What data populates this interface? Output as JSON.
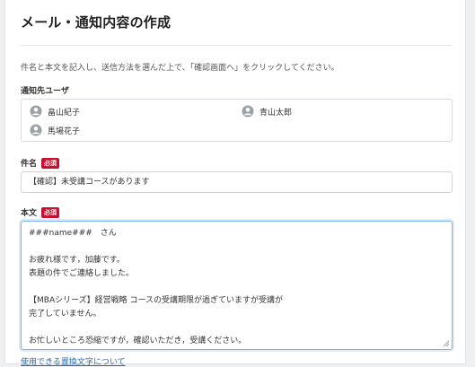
{
  "page": {
    "title": "メール・通知内容の作成",
    "instruction": "件名と本文を記入し、送信方法を選んだ上で、「確認画面へ」をクリックしてください。"
  },
  "recipients": {
    "label": "通知先ユーザ",
    "users": [
      "畠山紀子",
      "青山太郎",
      "馬場花子"
    ],
    "icon": "user-avatar-icon"
  },
  "subject": {
    "label": "件名",
    "required_badge": "必須",
    "value": "【確認】未受講コースがあります"
  },
  "body": {
    "label": "本文",
    "required_badge": "必須",
    "lines": [
      "###name###　さん",
      "",
      "お疲れ様です，加藤です。",
      "表題の件でご連絡しました。",
      "",
      "【MBAシリーズ】経営戦略 コースの受講期限が過ぎていますが受講が",
      "完了していません。",
      "",
      "お忙しいところ恐縮ですが，確認いただき，受講ください。"
    ]
  },
  "help_link": "使用できる置換文字について",
  "colors": {
    "required_badge": "#c8102e",
    "focus_border": "#7fb4e8",
    "link": "#2a6db0"
  }
}
